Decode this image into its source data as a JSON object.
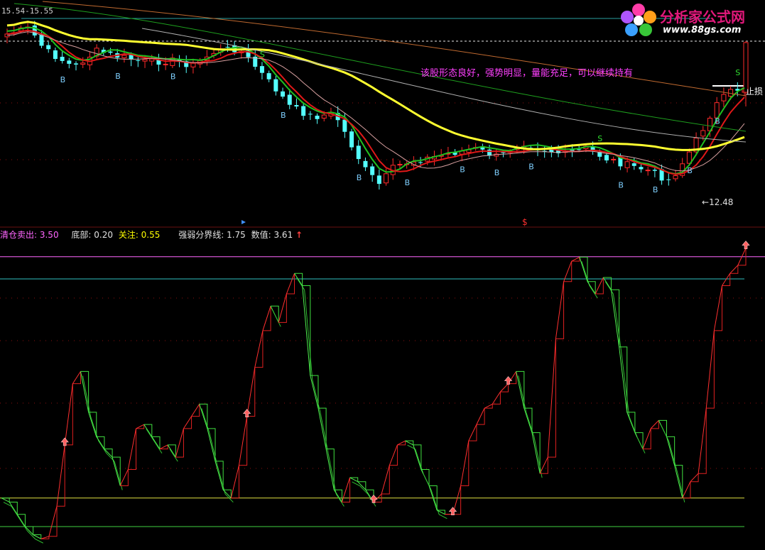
{
  "header": {
    "price_range": "15.54-15.55",
    "comment": "该股形态良好，强势明显，量能充足，可以继续持有",
    "stop_loss": "止损",
    "low_price": "12.48",
    "buy_mark": "B",
    "sell_mark": "S",
    "mid_mark": "$"
  },
  "indicator_legend": {
    "items": [
      {
        "label": "清仓卖出: 3.50",
        "color": "#ff66ff"
      },
      {
        "label": "底部: 0.20",
        "color": "#e0e0e0"
      },
      {
        "label": "关注: 0.55",
        "color": "#ffff00"
      },
      {
        "label": "强弱分界线: 1.75",
        "color": "#e0e0e0"
      },
      {
        "label": "数值: 3.61",
        "color": "#e0e0e0"
      }
    ],
    "up_arrow": "↑"
  },
  "logo": {
    "title": "分析家公式网",
    "url": "www.88gs.com"
  },
  "chart_data": [
    {
      "type": "candlestick",
      "title": "",
      "x": "bar index (daily)",
      "candles_y": "price",
      "ref_values": {
        "high_level": 15.55,
        "low": 12.48
      },
      "markers": {
        "B": [
          8,
          16,
          24,
          40,
          51,
          58,
          66,
          71,
          76,
          89,
          94,
          99,
          103
        ],
        "S": [
          37,
          86,
          106
        ]
      },
      "colors": {
        "up": "#ff2b2b",
        "down": "#54ffff",
        "ma_yellow": "#ffff30",
        "ma_green": "#20c020",
        "ma_red": "#e01818"
      }
    },
    {
      "type": "line",
      "title": "",
      "levels": {
        "sell": 3.5,
        "watch": 0.55,
        "bottom": 0.2,
        "divide": 1.75
      },
      "value": 3.61,
      "ylim": [
        0,
        3.65
      ],
      "series": [
        {
          "values": [
            0.55,
            0.5,
            0.35,
            0.2,
            0.1,
            0.05,
            0.08,
            0.45,
            1.2,
            1.95,
            2.1,
            1.6,
            1.3,
            1.15,
            1.05,
            0.7,
            0.9,
            1.4,
            1.45,
            1.3,
            1.15,
            1.2,
            1.05,
            1.4,
            1.55,
            1.7,
            1.4,
            1.0,
            0.65,
            0.55,
            0.95,
            1.55,
            2.15,
            2.6,
            2.9,
            2.7,
            3.05,
            3.3,
            3.15,
            2.05,
            1.65,
            1.15,
            0.65,
            0.5,
            0.8,
            0.75,
            0.65,
            0.5,
            0.6,
            0.95,
            1.2,
            1.25,
            1.2,
            0.9,
            0.7,
            0.4,
            0.35,
            0.35,
            0.7,
            1.25,
            1.45,
            1.65,
            1.7,
            1.85,
            1.95,
            2.1,
            1.65,
            1.35,
            0.85,
            1.05,
            2.5,
            3.2,
            3.45,
            3.5,
            3.2,
            3.05,
            3.25,
            3.1,
            2.4,
            1.6,
            1.35,
            1.15,
            1.4,
            1.5,
            1.3,
            0.95,
            0.55,
            0.75,
            0.85,
            1.65,
            2.6,
            3.15,
            3.3,
            3.4,
            3.61
          ]
        }
      ]
    }
  ]
}
